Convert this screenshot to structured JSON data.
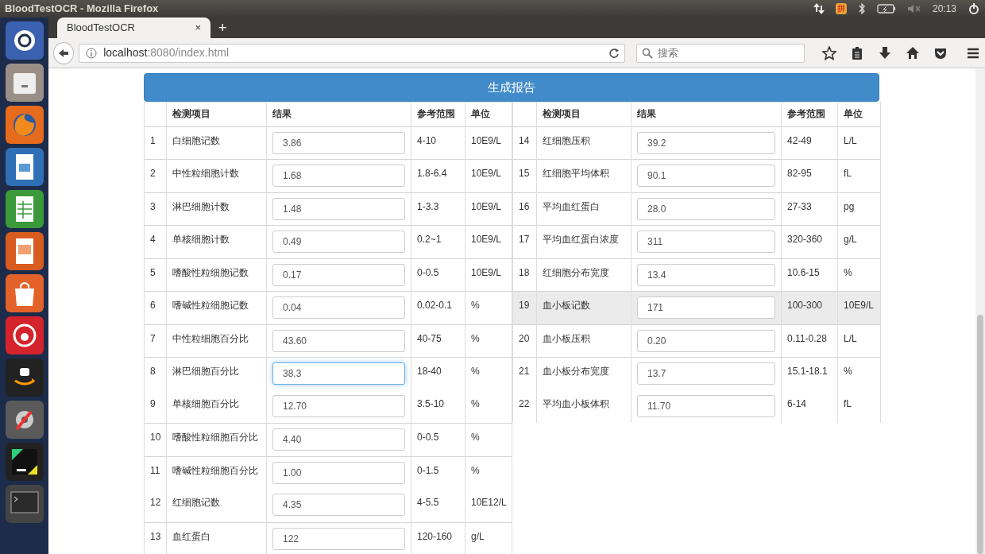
{
  "system_bar": {
    "window_title": "BloodTestOCR - Mozilla Firefox",
    "input_method": "拼",
    "time": "20:13"
  },
  "browser": {
    "tab": {
      "title": "BloodTestOCR",
      "close": "×",
      "selected": true
    },
    "new_tab": "+",
    "url": {
      "host": "localhost",
      "path": ":8080/index.html"
    },
    "search": {
      "placeholder": "搜索"
    }
  },
  "page": {
    "report_button": "生成报告",
    "tables": [
      {
        "columns": [
          "检测项目",
          "结果",
          "参考范围",
          "单位"
        ],
        "rows": [
          {
            "no": "1",
            "name": "白细胞记数",
            "value": "3.86",
            "range": "4-10",
            "unit": "10E9/L",
            "rule_above": true,
            "highlighted": false,
            "focused": false
          },
          {
            "no": "2",
            "name": "中性粒细胞计数",
            "value": "1.68",
            "range": "1.8-6.4",
            "unit": "10E9/L",
            "rule_above": true,
            "highlighted": false,
            "focused": false
          },
          {
            "no": "3",
            "name": "淋巴细胞计数",
            "value": "1.48",
            "range": "1-3.3",
            "unit": "10E9/L",
            "rule_above": true,
            "highlighted": false,
            "focused": false
          },
          {
            "no": "4",
            "name": "单核细胞计数",
            "value": "0.49",
            "range": "0.2~1",
            "unit": "10E9/L",
            "rule_above": true,
            "highlighted": false,
            "focused": false
          },
          {
            "no": "5",
            "name": "嗜酸性粒细胞记数",
            "value": "0.17",
            "range": "0-0.5",
            "unit": "10E9/L",
            "rule_above": true,
            "highlighted": false,
            "focused": false
          },
          {
            "no": "6",
            "name": "嗜碱性粒细胞记数",
            "value": "0.04",
            "range": "0.02-0.1",
            "unit": "%",
            "rule_above": true,
            "highlighted": false,
            "focused": false
          },
          {
            "no": "7",
            "name": "中性粒细胞百分比",
            "value": "43.60",
            "range": "40-75",
            "unit": "%",
            "rule_above": true,
            "highlighted": false,
            "focused": false
          },
          {
            "no": "8",
            "name": "淋巴细胞百分比",
            "value": "38.3",
            "range": "18-40",
            "unit": "%",
            "rule_above": true,
            "highlighted": false,
            "focused": true
          },
          {
            "no": "9",
            "name": "单核细胞百分比",
            "value": "12.70",
            "range": "3.5-10",
            "unit": "%",
            "rule_above": false,
            "highlighted": false,
            "focused": false
          },
          {
            "no": "10",
            "name": "嗜酸性粒细胞百分比",
            "value": "4.40",
            "range": "0-0.5",
            "unit": "%",
            "rule_above": true,
            "highlighted": false,
            "focused": false
          },
          {
            "no": "11",
            "name": "嗜碱性粒细胞百分比",
            "value": "1.00",
            "range": "0-1.5",
            "unit": "%",
            "rule_above": true,
            "highlighted": false,
            "focused": false
          },
          {
            "no": "12",
            "name": "红细胞记数",
            "value": "4.35",
            "range": "4-5.5",
            "unit": "10E12/L",
            "rule_above": false,
            "highlighted": false,
            "focused": false
          },
          {
            "no": "13",
            "name": "血红蛋白",
            "value": "122",
            "range": "120-160",
            "unit": "g/L",
            "rule_above": true,
            "highlighted": false,
            "focused": false
          }
        ]
      },
      {
        "columns": [
          "检测项目",
          "结果",
          "参考范围",
          "单位"
        ],
        "rows": [
          {
            "no": "14",
            "name": "红细胞压积",
            "value": "39.2",
            "range": "42-49",
            "unit": "L/L",
            "rule_above": true,
            "highlighted": false,
            "focused": false
          },
          {
            "no": "15",
            "name": "红细胞平均体积",
            "value": "90.1",
            "range": "82-95",
            "unit": "fL",
            "rule_above": true,
            "highlighted": false,
            "focused": false
          },
          {
            "no": "16",
            "name": "平均血红蛋白",
            "value": "28.0",
            "range": "27-33",
            "unit": "pg",
            "rule_above": true,
            "highlighted": false,
            "focused": false
          },
          {
            "no": "17",
            "name": "平均血红蛋白浓度",
            "value": "311",
            "range": "320-360",
            "unit": "g/L",
            "rule_above": true,
            "highlighted": false,
            "focused": false
          },
          {
            "no": "18",
            "name": "红细胞分布宽度",
            "value": "13.4",
            "range": "10.6-15",
            "unit": "%",
            "rule_above": true,
            "highlighted": false,
            "focused": false
          },
          {
            "no": "19",
            "name": "血小板记数",
            "value": "171",
            "range": "100-300",
            "unit": "10E9/L",
            "rule_above": true,
            "highlighted": true,
            "focused": false
          },
          {
            "no": "20",
            "name": "血小板压积",
            "value": "0.20",
            "range": "0.11-0.28",
            "unit": "L/L",
            "rule_above": true,
            "highlighted": false,
            "focused": false
          },
          {
            "no": "21",
            "name": "血小板分布宽度",
            "value": "13.7",
            "range": "15.1-18.1",
            "unit": "%",
            "rule_above": true,
            "highlighted": false,
            "focused": false
          },
          {
            "no": "22",
            "name": "平均血小板体积",
            "value": "11.70",
            "range": "6-14",
            "unit": "fL",
            "rule_above": false,
            "highlighted": false,
            "focused": false
          }
        ]
      }
    ]
  }
}
